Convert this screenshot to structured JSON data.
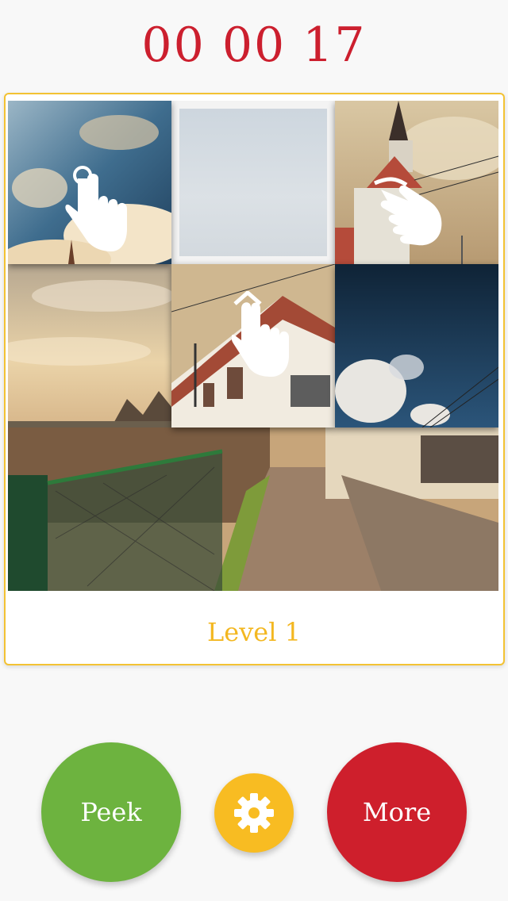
{
  "timer": "00 00 17",
  "level_label": "Level 1",
  "buttons": {
    "peek": "Peek",
    "more": "More"
  },
  "icons": {
    "settings": "gear-icon",
    "gesture_tap": "tap-hand-icon",
    "gesture_swipe_left": "swipe-left-hand-icon",
    "gesture_swipe_up": "swipe-up-hand-icon"
  },
  "colors": {
    "timer": "#cc1f2e",
    "level": "#f3b720",
    "card_border": "#f3c233",
    "peek": "#6db33f",
    "settings": "#f8bc22",
    "more": "#ce1f2c"
  }
}
